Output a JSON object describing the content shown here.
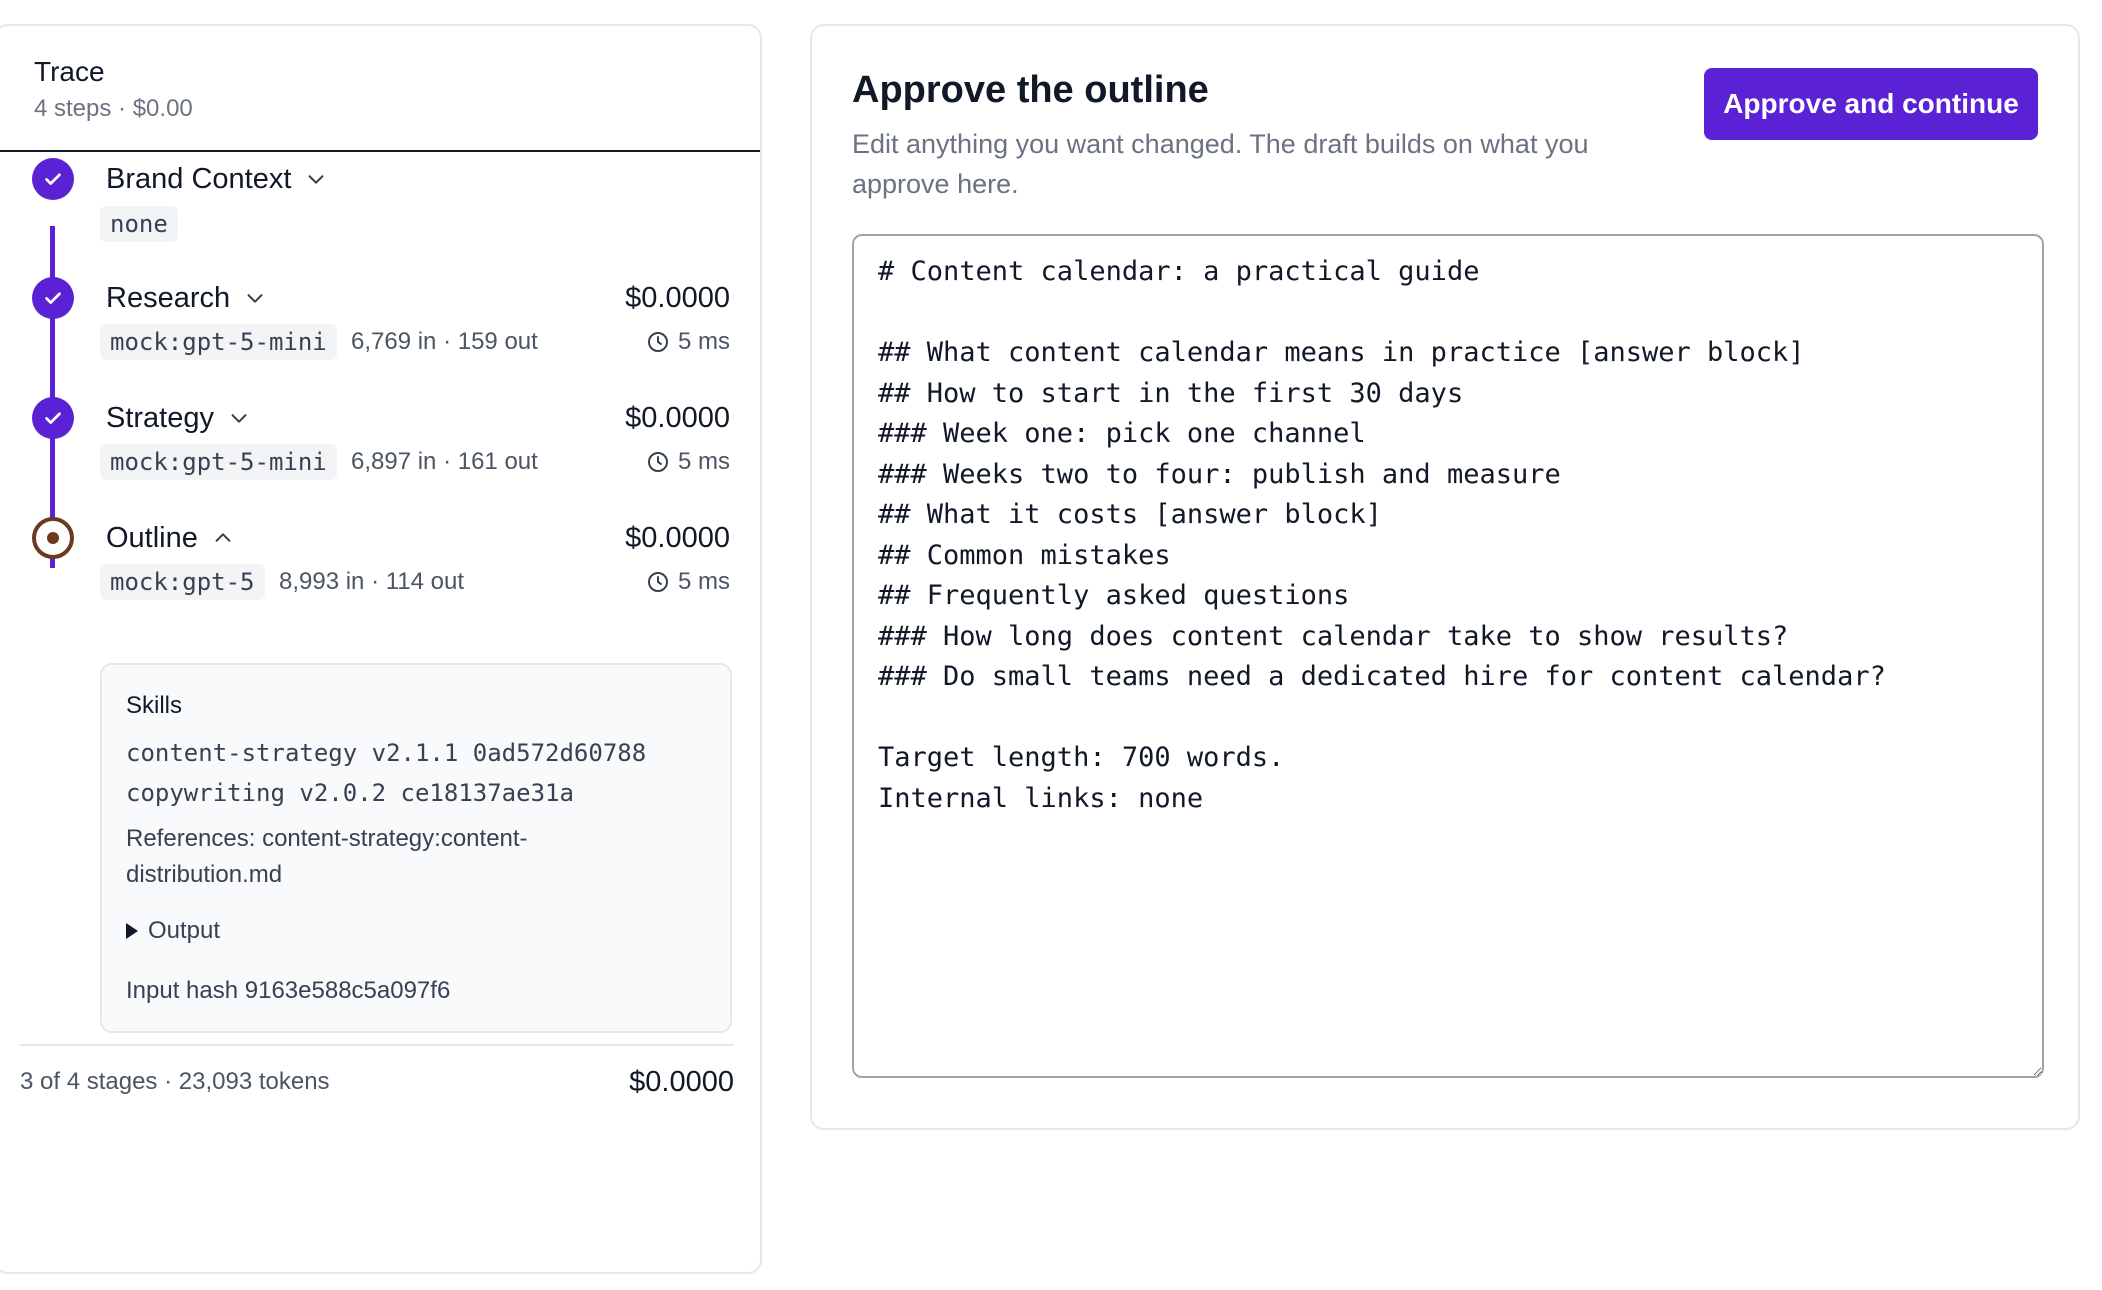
{
  "trace": {
    "title": "Trace",
    "subtitle": "4 steps · $0.00",
    "steps": [
      {
        "name": "Brand Context",
        "status": "done",
        "chip": "none",
        "expanded": false
      },
      {
        "name": "Research",
        "status": "done",
        "cost": "$0.0000",
        "model": "mock:gpt-5-mini",
        "tokens": "6,769 in · 159 out",
        "duration": "5 ms",
        "expanded": false
      },
      {
        "name": "Strategy",
        "status": "done",
        "cost": "$0.0000",
        "model": "mock:gpt-5-mini",
        "tokens": "6,897 in · 161 out",
        "duration": "5 ms",
        "expanded": false
      },
      {
        "name": "Outline",
        "status": "current",
        "cost": "$0.0000",
        "model": "mock:gpt-5",
        "tokens": "8,993 in · 114 out",
        "duration": "5 ms",
        "expanded": true
      }
    ],
    "details": {
      "skills_title": "Skills",
      "skills": [
        "content-strategy v2.1.1 0ad572d60788",
        "copywriting v2.0.2 ce18137ae31a"
      ],
      "references": "References: content-strategy:content-distribution.md",
      "output_label": "Output",
      "input_hash": "Input hash 9163e588c5a097f6"
    },
    "footer": {
      "summary": "3 of 4 stages · 23,093 tokens",
      "cost": "$0.0000"
    }
  },
  "approve": {
    "title": "Approve the outline",
    "description": "Edit anything you want changed. The draft builds on what you approve here.",
    "button_label": "Approve and continue",
    "outline_text": "# Content calendar: a practical guide\n\n## What content calendar means in practice [answer block]\n## How to start in the first 30 days\n### Week one: pick one channel\n### Weeks two to four: publish and measure\n## What it costs [answer block]\n## Common mistakes\n## Frequently asked questions\n### How long does content calendar take to show results?\n### Do small teams need a dedicated hire for content calendar?\n\nTarget length: 700 words.\nInternal links: none"
  },
  "colors": {
    "accent": "#5b21d4",
    "current_step": "#6b3a1f",
    "muted_text": "#6b7280",
    "border": "#e5e7eb"
  },
  "icons": {
    "step_done": "check-icon",
    "step_current": "current-step-icon",
    "collapsed": "chevron-down-icon",
    "expanded": "chevron-up-icon",
    "duration": "clock-icon",
    "disclosure": "triangle-right-icon"
  }
}
